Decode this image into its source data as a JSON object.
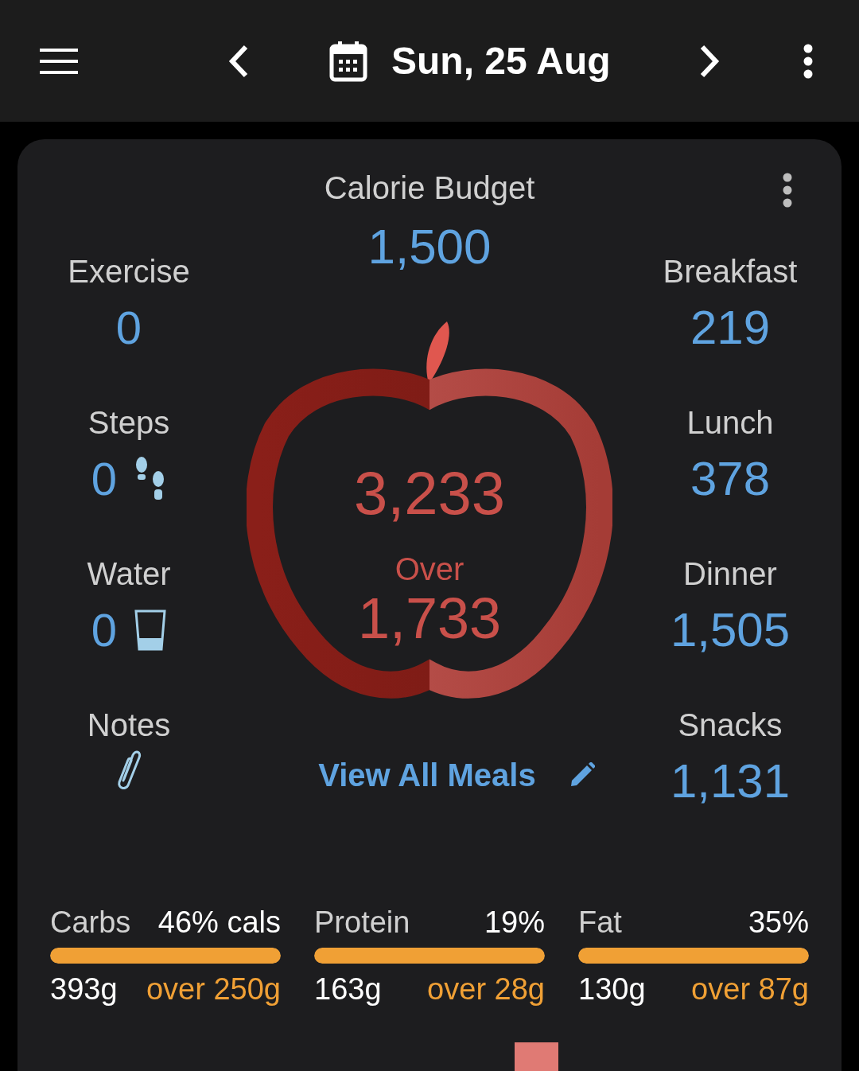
{
  "header": {
    "date": "Sun, 25 Aug"
  },
  "budget": {
    "label": "Calorie Budget",
    "value": "1,500"
  },
  "left_items": [
    {
      "kind": "plain",
      "label": "Exercise",
      "value": "0"
    },
    {
      "kind": "steps",
      "label": "Steps",
      "value": "0"
    },
    {
      "kind": "water",
      "label": "Water",
      "value": "0"
    },
    {
      "kind": "notes",
      "label": "Notes"
    }
  ],
  "meals": [
    {
      "label": "Breakfast",
      "value": "219"
    },
    {
      "label": "Lunch",
      "value": "378"
    },
    {
      "label": "Dinner",
      "value": "1,505"
    },
    {
      "label": "Snacks",
      "value": "1,131"
    }
  ],
  "apple": {
    "total": "3,233",
    "status": "Over",
    "difference": "1,733"
  },
  "link": "View All Meals",
  "macros": [
    {
      "name": "Carbs",
      "percent": "46% cals",
      "level": 1,
      "amount": "393g",
      "target": "over 250g"
    },
    {
      "name": "Protein",
      "percent": "19%",
      "level": 1,
      "amount": "163g",
      "target": "over 28g"
    },
    {
      "name": "Fat",
      "percent": "35%",
      "level": 1,
      "amount": "130g",
      "target": "over 87g"
    }
  ]
}
